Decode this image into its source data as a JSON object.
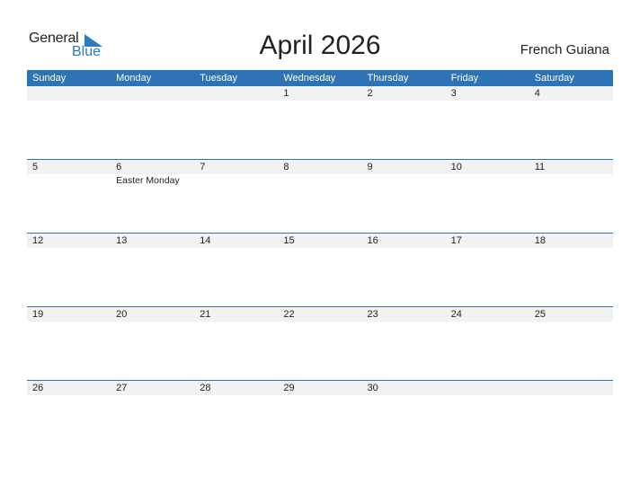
{
  "logo": {
    "line1": "General",
    "line2": "Blue",
    "accent": "#2a7bc0"
  },
  "title": "April 2026",
  "country": "French Guiana",
  "colors": {
    "header_bg": "#2e73b5",
    "date_strip": "#f2f2f2"
  },
  "weekdays": [
    "Sunday",
    "Monday",
    "Tuesday",
    "Wednesday",
    "Thursday",
    "Friday",
    "Saturday"
  ],
  "weeks": [
    {
      "days": [
        "",
        "",
        "",
        "1",
        "2",
        "3",
        "4"
      ],
      "events": [
        "",
        "",
        "",
        "",
        "",
        "",
        ""
      ]
    },
    {
      "days": [
        "5",
        "6",
        "7",
        "8",
        "9",
        "10",
        "11"
      ],
      "events": [
        "",
        "Easter Monday",
        "",
        "",
        "",
        "",
        ""
      ]
    },
    {
      "days": [
        "12",
        "13",
        "14",
        "15",
        "16",
        "17",
        "18"
      ],
      "events": [
        "",
        "",
        "",
        "",
        "",
        "",
        ""
      ]
    },
    {
      "days": [
        "19",
        "20",
        "21",
        "22",
        "23",
        "24",
        "25"
      ],
      "events": [
        "",
        "",
        "",
        "",
        "",
        "",
        ""
      ]
    },
    {
      "days": [
        "26",
        "27",
        "28",
        "29",
        "30",
        "",
        ""
      ],
      "events": [
        "",
        "",
        "",
        "",
        "",
        "",
        ""
      ]
    }
  ]
}
